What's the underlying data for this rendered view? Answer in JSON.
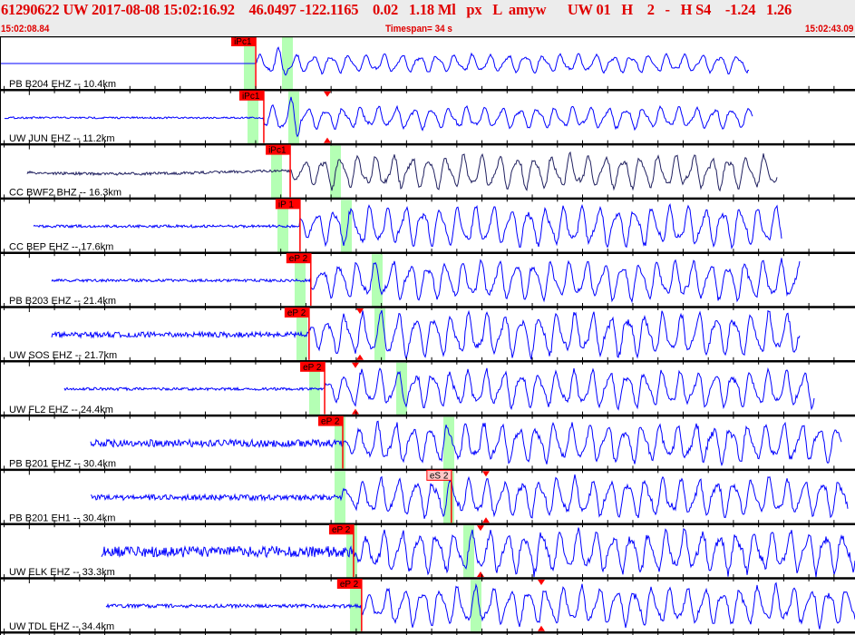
{
  "header": {
    "title": "61290622 UW 2017-08-08 15:02:16.92    46.0497 -122.1165    0.02   1.18 Ml   px   L  amyw      UW 01   H    2   -   H S4    -1.24   1.26",
    "start_time": "15:02:08.84",
    "timespan_label": "Timespan=  34 s",
    "end_time": "15:02:43.09"
  },
  "timespan_seconds": 34,
  "colors": {
    "header_text": "#e00000",
    "trace": "#0000ff",
    "trace_alt": "#202060",
    "pick": "#ff0000",
    "s_pick_bg": "#ffc8c8",
    "window": "#b4ffb4"
  },
  "traces": [
    {
      "label": "PB B204 EHZ -- 10.4km",
      "pick": "iPc1",
      "pick_time": 10.17,
      "s_time": null,
      "color": "#0000ff"
    },
    {
      "label": "UW JUN EHZ -- 11.2km",
      "pick": "iPc1",
      "pick_time": 10.49,
      "s_time": null,
      "color": "#0000ff"
    },
    {
      "label": "CC BWF2 BHZ -- 16.3km",
      "pick": "iPc1",
      "pick_time": 11.54,
      "s_time": null,
      "color": "#202060"
    },
    {
      "label": "CC BEP EHZ -- 17.6km",
      "pick": "iP 1",
      "pick_time": 11.93,
      "s_time": null,
      "color": "#0000ff"
    },
    {
      "label": "PB B203 EHZ -- 21.4km",
      "pick": "eP 2",
      "pick_time": 12.36,
      "s_time": null,
      "color": "#0000ff"
    },
    {
      "label": "UW SOS EHZ -- 21.7km",
      "pick": "eP 2",
      "pick_time": 12.29,
      "s_time": null,
      "color": "#0000ff"
    },
    {
      "label": "UW FL2 EHZ -- 24.4km",
      "pick": "eP 2",
      "pick_time": 12.91,
      "s_time": null,
      "color": "#0000ff"
    },
    {
      "label": "PB B201 EHZ -- 30.4km",
      "pick": "eP 2",
      "pick_time": 13.63,
      "s_time": null,
      "color": "#0000ff"
    },
    {
      "label": "PB B201 EH1 -- 30.4km",
      "pick": "eS 2",
      "pick_time": 17.95,
      "s_time": null,
      "color": "#0000ff"
    },
    {
      "label": "UW ELK EHZ -- 33.3km",
      "pick": "eP 2",
      "pick_time": 14.06,
      "s_time": null,
      "color": "#0000ff"
    },
    {
      "label": "UW TDL EHZ -- 34.4km",
      "pick": "eP 2",
      "pick_time": 14.38,
      "s_time": null,
      "color": "#0000ff"
    }
  ]
}
